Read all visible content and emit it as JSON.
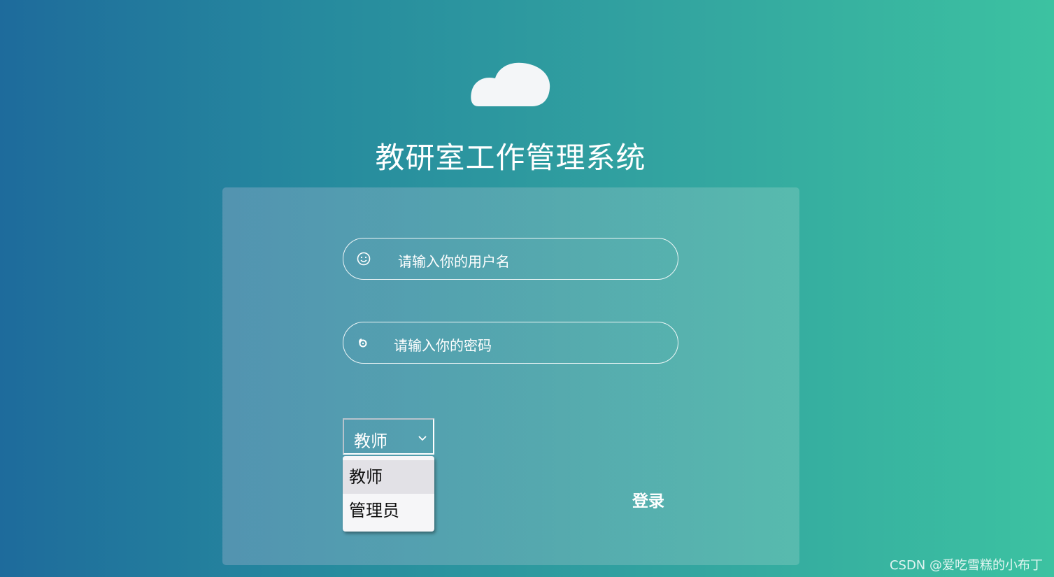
{
  "page": {
    "title": "教研室工作管理系统",
    "logo_icon": "cloud-icon"
  },
  "login_form": {
    "username": {
      "icon": "smiley-icon",
      "placeholder": "请输入你的用户名",
      "value": ""
    },
    "password": {
      "icon": "key-icon",
      "placeholder": "请输入你的密码",
      "value": ""
    },
    "role_select": {
      "selected": "教师",
      "options": [
        "教师",
        "管理员"
      ],
      "expanded": true
    },
    "login_label": "登录"
  },
  "watermark": "CSDN @爱吃雪糕的小布丁",
  "colors": {
    "gradient_left": "#1e6b9c",
    "gradient_right": "#3cc2a1",
    "text": "#ffffff"
  }
}
